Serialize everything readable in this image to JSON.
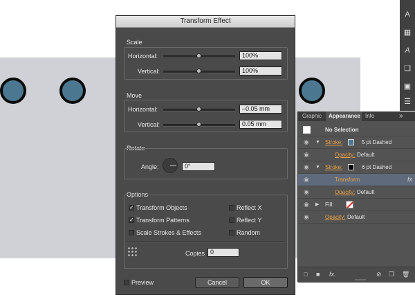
{
  "dialog": {
    "title": "Transform Effect",
    "scale": {
      "heading": "Scale",
      "horizontal_label": "Horizontal:",
      "horizontal_value": "100%",
      "vertical_label": "Vertical:",
      "vertical_value": "100%"
    },
    "move": {
      "heading": "Move",
      "horizontal_label": "Horizontal:",
      "horizontal_value": "–0.05 mm",
      "vertical_label": "Vertical:",
      "vertical_value": "0.05 mm"
    },
    "rotate": {
      "heading": "Rotate",
      "angle_label": "Angle:",
      "angle_value": "0°"
    },
    "options": {
      "heading": "Options",
      "transform_objects": "Transform Objects",
      "transform_patterns": "Transform Patterns",
      "scale_strokes": "Scale Strokes & Effects",
      "reflect_x": "Reflect X",
      "reflect_y": "Reflect Y",
      "random": "Random",
      "copies_label": "Copies",
      "copies_value": "0",
      "check_mark": "✓"
    },
    "preview_label": "Preview",
    "cancel_label": "Cancel",
    "ok_label": "OK"
  },
  "panel": {
    "tabs": [
      "Graphic S",
      "Appearance",
      "Info"
    ],
    "menu_glyph": "»",
    "no_selection": "No Selection",
    "rows": {
      "stroke1_label": "Stroke:",
      "stroke1_value": "5 pt Dashed",
      "opacity1_label": "Opacity:",
      "opacity1_value": "Default",
      "stroke2_label": "Stroke:",
      "stroke2_value": "6 pt Dashed",
      "transform_label": "Transform",
      "fx_glyph": "fx",
      "opacity2_label": "Opacity:",
      "opacity2_value": "Default",
      "fill_label": "Fill:",
      "opacity3_label": "Opacity:",
      "opacity3_value": "Default"
    },
    "bottom_fx": "fx."
  },
  "colors": {
    "canvas": "#cfd1d6",
    "circle_fill": "#4b7890",
    "dialog_bg": "#4a4a4a",
    "highlight_row": "#5f6b7d",
    "link_orange": "#e8a046"
  }
}
